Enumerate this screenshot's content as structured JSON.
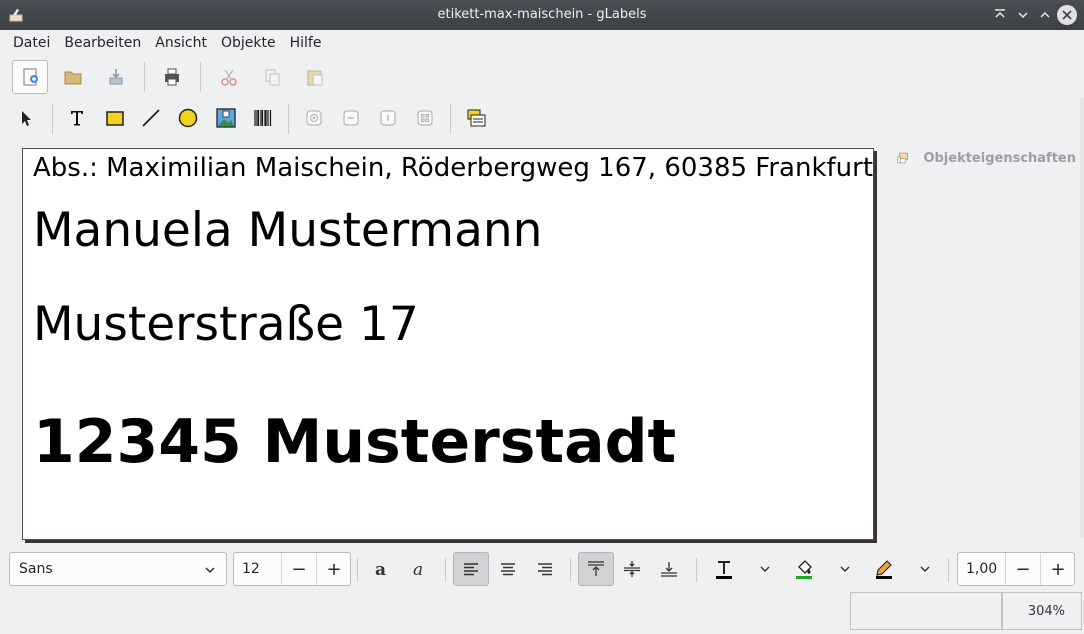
{
  "window": {
    "title": "etikett-max-maischein - gLabels"
  },
  "menu": [
    "Datei",
    "Bearbeiten",
    "Ansicht",
    "Objekte",
    "Hilfe"
  ],
  "label": {
    "sender": "Abs.: Maximilian Maischein, Röderbergweg 167, 60385 Frankfurt",
    "name": "Manuela Mustermann",
    "street": "Musterstraße 17",
    "city": "12345 Musterstadt"
  },
  "side_panel": {
    "properties_label": "Objekteigenschaften"
  },
  "format_bar": {
    "font_family": "Sans",
    "font_size": "12",
    "line_width": "1,00",
    "text_color": "#000000",
    "fill_color": "#1fa91f",
    "line_color": "#000000"
  },
  "status": {
    "zoom": "304%"
  },
  "icons": {
    "toolbar1": [
      "new-icon",
      "open-icon",
      "save-icon",
      "print-icon",
      "cut-icon",
      "copy-icon",
      "paste-icon"
    ],
    "toolbar2": [
      "arrow-icon",
      "text-icon",
      "box-icon",
      "line-icon",
      "ellipse-icon",
      "image-icon",
      "barcode-icon",
      "zoom-in-icon",
      "zoom-out-icon",
      "zoom-1-icon",
      "zoom-fit-icon",
      "merge-icon"
    ]
  }
}
